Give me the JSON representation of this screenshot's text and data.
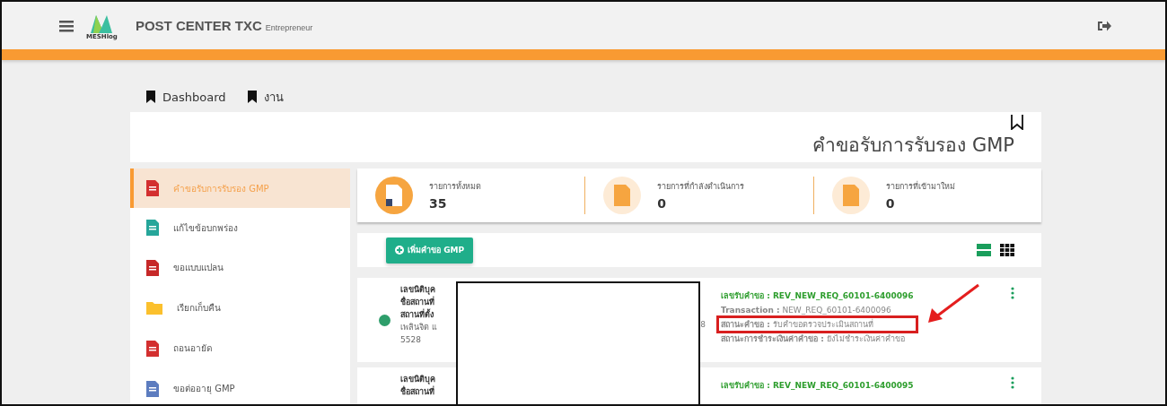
{
  "header": {
    "title": "POST CENTER TXC",
    "subtitle": "Entrepreneur",
    "logo_text": "MESHlog"
  },
  "nav_tabs": [
    {
      "label": "Dashboard"
    },
    {
      "label": "งาน"
    }
  ],
  "page_title": "คำขอรับการรับรอง GMP",
  "sidebar": {
    "items": [
      {
        "label": "คำขอรับการรับรอง GMP",
        "selected": true,
        "kind": "document",
        "color": "#d32f2f"
      },
      {
        "label": "แก้ไขข้อบกพร่อง",
        "selected": false,
        "kind": "document",
        "color": "#26a69a"
      },
      {
        "label": "ขอแบบแปลน",
        "selected": false,
        "kind": "document",
        "color": "#c62828"
      },
      {
        "label": "เรียกเก็บคืน",
        "selected": false,
        "kind": "folder",
        "color": "#fbc02d"
      },
      {
        "label": "ถอนอายัด",
        "selected": false,
        "kind": "document",
        "color": "#d32f2f"
      },
      {
        "label": "ขอต่ออายุ GMP",
        "selected": false,
        "kind": "document",
        "color": "#5c7cbf"
      }
    ]
  },
  "stats": [
    {
      "label": "รายการทั้งหมด",
      "value": "35",
      "kind": "solid"
    },
    {
      "label": "รายการที่กำลังดำเนินการ",
      "value": "0",
      "kind": "cycle"
    },
    {
      "label": "รายการที่เข้ามาใหม่",
      "value": "0",
      "kind": "light"
    }
  ],
  "add_button": {
    "label": "เพิ่มคำขอ GMP"
  },
  "view_toggle": [
    {
      "kind": "list",
      "selected": true
    },
    {
      "kind": "grid",
      "selected": false
    }
  ],
  "requests": [
    {
      "color": "#2e9e6b",
      "left_lines": [
        "เลขนิติบุค",
        "ชื่อสถานที่",
        "สถานที่ตั้ง",
        "เพลินจิต แ",
        "5528"
      ],
      "cut_text": "8",
      "fields": [
        {
          "label": "เลขรับคำขอ :",
          "value": "REV_NEW_REQ_60101-6400096",
          "kind": "id",
          "highlighted": false
        },
        {
          "label": "Transaction :",
          "value": "NEW_REQ_60101-6400096",
          "kind": "plain",
          "highlighted": false
        },
        {
          "label": "สถานะคำขอ :",
          "value": "รับคำขอตรวจประเมินสถานที่",
          "kind": "status",
          "highlighted": true
        },
        {
          "label": "สถานะการชำระเงินค่าคำขอ :",
          "value": "ยังไม่ชำระเงินค่าคำขอ",
          "kind": "status",
          "highlighted": false
        }
      ]
    },
    {
      "left_lines": [
        "เลขนิติบุค",
        "ชื่อสถานที่"
      ],
      "fields": [
        {
          "label": "เลขรับคำขอ :",
          "value": "REV_NEW_REQ_60101-6400095",
          "kind": "id",
          "highlighted": false
        }
      ]
    }
  ]
}
